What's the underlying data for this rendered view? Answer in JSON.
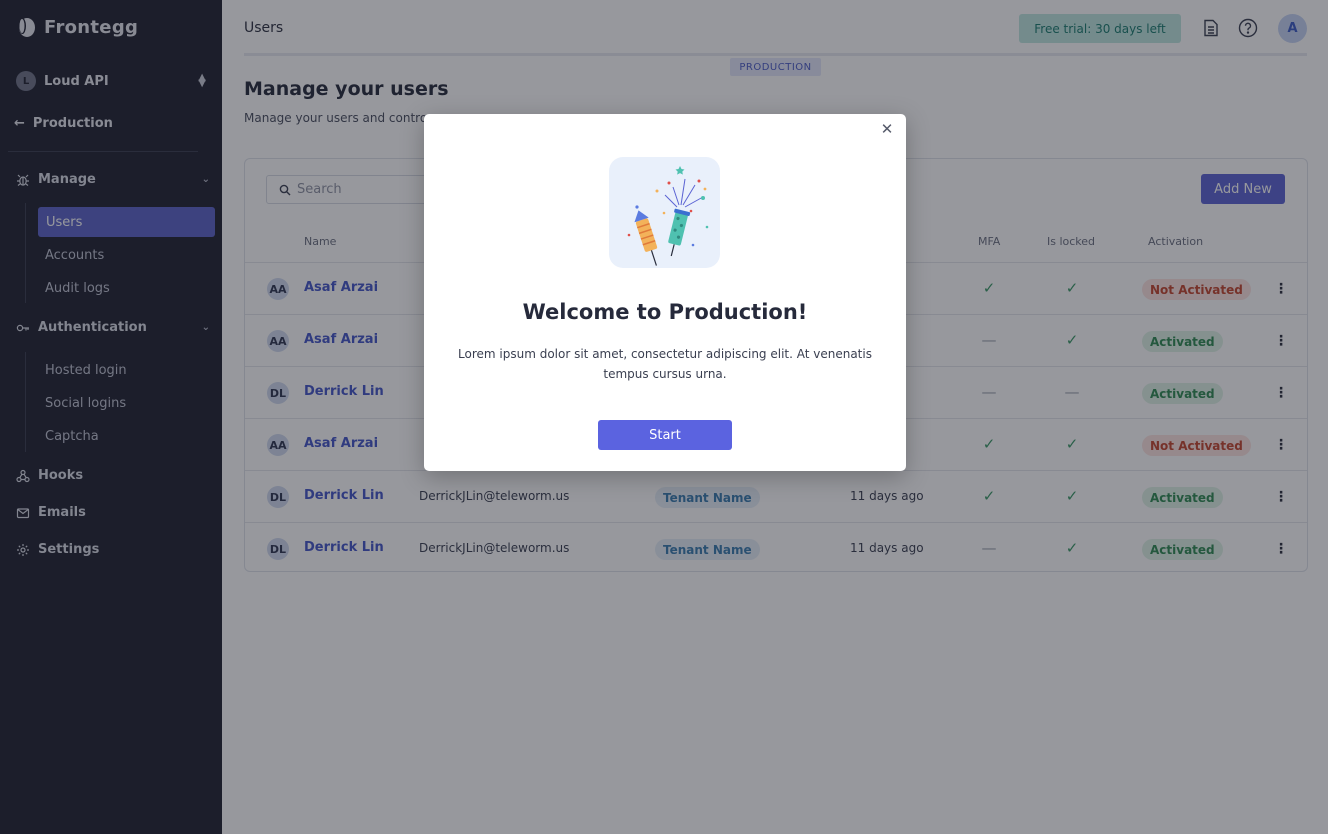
{
  "app": {
    "brand": "Frontegg"
  },
  "sidebar": {
    "workspace": {
      "initial": "L",
      "name": "Loud API"
    },
    "environment": "Production",
    "sections": [
      {
        "label": "Manage",
        "items": [
          "Users",
          "Accounts",
          "Audit logs"
        ],
        "active": "Users"
      },
      {
        "label": "Authentication",
        "items": [
          "Hosted login",
          "Social logins",
          "Captcha"
        ]
      }
    ],
    "links": [
      "Hooks",
      "Emails",
      "Settings"
    ]
  },
  "topbar": {
    "title": "Users",
    "trial": "Free trial: 30 days left",
    "user_initial": "A"
  },
  "page": {
    "env_badge": "PRODUCTION",
    "title": "Manage your users",
    "subtitle": "Manage your users and contro"
  },
  "table": {
    "search_placeholder": "Search",
    "add_button": "Add New",
    "headers": {
      "name": "Name",
      "mfa": "MFA",
      "locked": "Is locked",
      "activation": "Activation"
    },
    "rows": [
      {
        "initials": "AA",
        "name": "Asaf Arzai",
        "email": "",
        "tenant": "",
        "created": "",
        "mfa": true,
        "locked": true,
        "status": "Not Activated"
      },
      {
        "initials": "AA",
        "name": "Asaf Arzai",
        "email": "",
        "tenant": "",
        "created": "",
        "mfa": false,
        "locked": true,
        "status": "Activated"
      },
      {
        "initials": "DL",
        "name": "Derrick Lin",
        "email": "",
        "tenant": "",
        "created": "",
        "mfa": false,
        "locked": false,
        "status": "Activated"
      },
      {
        "initials": "AA",
        "name": "Asaf Arzai",
        "email": "",
        "tenant": "",
        "created": "",
        "mfa": true,
        "locked": true,
        "status": "Not Activated"
      },
      {
        "initials": "DL",
        "name": "Derrick Lin",
        "email": "DerrickJLin@teleworm.us",
        "tenant": "Tenant Name",
        "created": "11 days ago",
        "mfa": true,
        "locked": true,
        "status": "Activated"
      },
      {
        "initials": "DL",
        "name": "Derrick Lin",
        "email": "DerrickJLin@teleworm.us",
        "tenant": "Tenant Name",
        "created": "11 days ago",
        "mfa": false,
        "locked": true,
        "status": "Activated"
      }
    ]
  },
  "modal": {
    "title": "Welcome to Production!",
    "text": "Lorem ipsum dolor sit amet, consectetur adipiscing elit. At venenatis tempus cursus urna.",
    "button": "Start"
  },
  "colors": {
    "sidebar_bg": "#1f2130",
    "accent": "#5b63d3",
    "active_nav": "#5b63c9",
    "not_activated": "#c4452f",
    "activated": "#2f8a52"
  }
}
